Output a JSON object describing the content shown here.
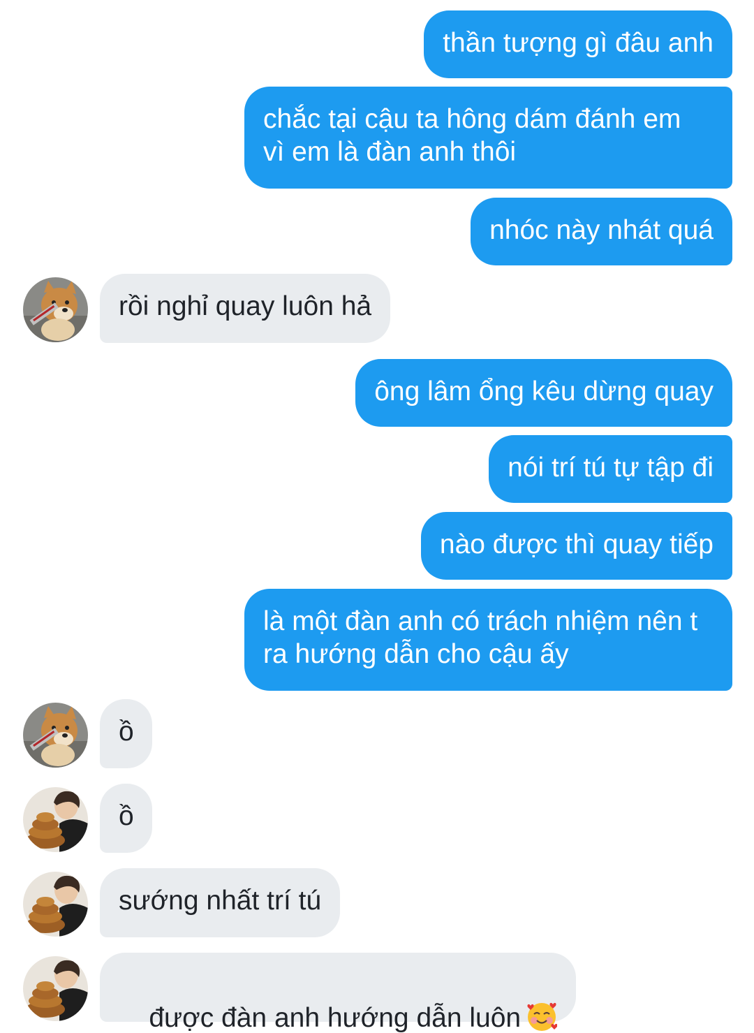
{
  "messages": [
    {
      "text": "thần tượng gì đâu anh"
    },
    {
      "text": "chắc tại cậu ta hông dám đánh em\nvì em là đàn anh thôi"
    },
    {
      "text": "nhóc này nhát quá"
    },
    {
      "text": "rồi nghỉ quay luôn hả"
    },
    {
      "text": "ông lâm ổng kêu dừng quay"
    },
    {
      "text": "nói trí tú tự tập đi"
    },
    {
      "text": "nào được thì quay tiếp"
    },
    {
      "text": "là một đàn anh có trách nhiệm nên t\nra hướng dẫn cho cậu ấy"
    },
    {
      "text": "ồ"
    },
    {
      "text": "ồ"
    },
    {
      "text": "sướng nhất trí tú"
    },
    {
      "text": "được đàn anh hướng dẫn luôn"
    }
  ],
  "icons": {
    "avatar_a": "shiba-dog-avatar",
    "avatar_b": "person-with-bread-avatar",
    "emoji": "smiling-face-with-hearts-icon"
  },
  "colors": {
    "outgoing_bubble": "#1d9bf0",
    "incoming_bubble": "#e9ecef"
  }
}
